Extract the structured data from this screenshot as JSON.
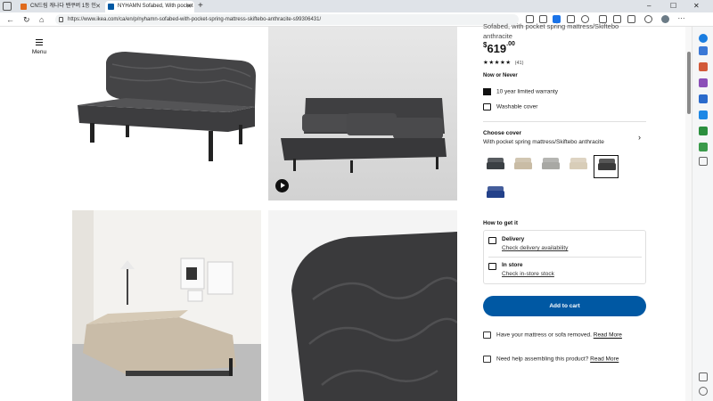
{
  "browser": {
    "tabs": [
      {
        "title": "CN드림 캐나다 밴쿠버 1등 인",
        "active": false,
        "favicon_color": "#e06a1c"
      },
      {
        "title": "NYHAMN Sofabed, With pocket",
        "active": true,
        "favicon_color": "#0058a3"
      }
    ],
    "url": "https://www.ikea.com/ca/en/p/nyhamn-sofabed-with-pocket-spring-mattress-skiftebo-anthracite-s99306431/",
    "window_controls": [
      "–",
      "☐",
      "✕"
    ]
  },
  "page": {
    "menu_label": "Menu",
    "product_subtitle": "Sofabed, with pocket spring mattress/Skiftebo anthracite",
    "price": {
      "currency": "$",
      "integer": "619",
      "decimal": ".00"
    },
    "rating": {
      "stars": "★★★★★",
      "value": 4.5,
      "count": "(41)"
    },
    "badge": "Now or Never",
    "features": [
      {
        "icon": "warranty-10-icon",
        "label": "10 year limited warranty"
      },
      {
        "icon": "washable-icon",
        "label": "Washable cover"
      }
    ],
    "choose_cover": {
      "title": "Choose cover",
      "selected": "With pocket spring mattress/Skiftebo anthracite",
      "swatches": [
        {
          "name": "dark-blue-gray",
          "color": "#3b4044",
          "selected": false
        },
        {
          "name": "beige",
          "color": "#c9bca5",
          "selected": false
        },
        {
          "name": "light-gray",
          "color": "#a8a8a4",
          "selected": false
        },
        {
          "name": "light-beige",
          "color": "#d8cdb8",
          "selected": false
        },
        {
          "name": "anthracite",
          "color": "#3a3a3a",
          "selected": true
        },
        {
          "name": "blue",
          "color": "#23418a",
          "selected": false
        }
      ]
    },
    "how_to_get": {
      "title": "How to get it",
      "delivery": {
        "label": "Delivery",
        "link": "Check delivery availability"
      },
      "instore": {
        "label": "In store",
        "link": "Check in-store stock"
      }
    },
    "add_to_cart": "Add to cart",
    "help": [
      {
        "text": "Have your mattress or sofa removed.",
        "link": "Read More"
      },
      {
        "text": "Need help assembling this product?",
        "link": "Read More"
      }
    ]
  }
}
